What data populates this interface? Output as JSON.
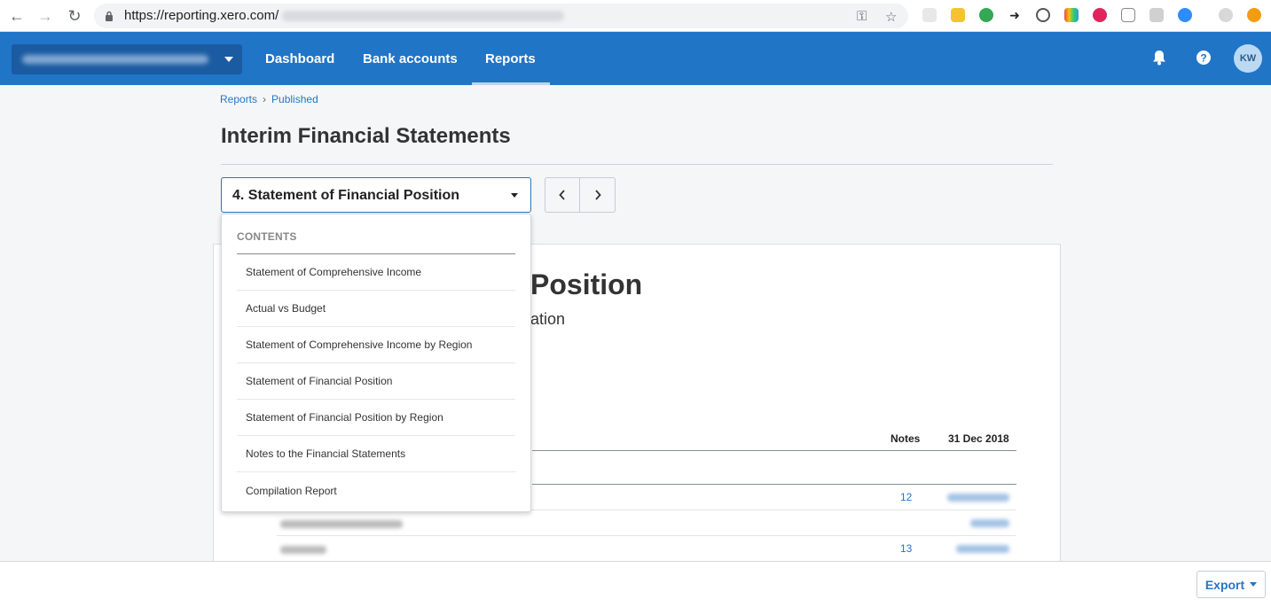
{
  "browser": {
    "url": "https://reporting.xero.com/"
  },
  "header": {
    "nav": [
      {
        "label": "Dashboard"
      },
      {
        "label": "Bank accounts"
      },
      {
        "label": "Reports"
      }
    ],
    "active_nav": "Reports",
    "avatar_initials": "KW"
  },
  "breadcrumb": {
    "items": [
      "Reports",
      "Published"
    ],
    "separator": "›"
  },
  "page": {
    "title": "Interim Financial Statements"
  },
  "report_selector": {
    "selected": "4. Statement of Financial Position"
  },
  "dropdown": {
    "heading": "CONTENTS",
    "items": [
      "Statement of Comprehensive Income",
      "Actual vs Budget",
      "Statement of Comprehensive Income by Region",
      "Statement of Financial Position",
      "Statement of Financial Position by Region",
      "Notes to the Financial Statements",
      "Compilation Report"
    ]
  },
  "report_preview": {
    "heading_visible": "Position",
    "subheading_visible": "ation",
    "columns": [
      "Notes",
      "31 Dec 2018"
    ],
    "rows": [
      {
        "note": "12"
      },
      {
        "note": ""
      },
      {
        "note": "13"
      }
    ]
  },
  "footer": {
    "export_label": "Export"
  },
  "colors": {
    "brand_blue": "#2075c7",
    "link_blue": "#2576c7"
  }
}
